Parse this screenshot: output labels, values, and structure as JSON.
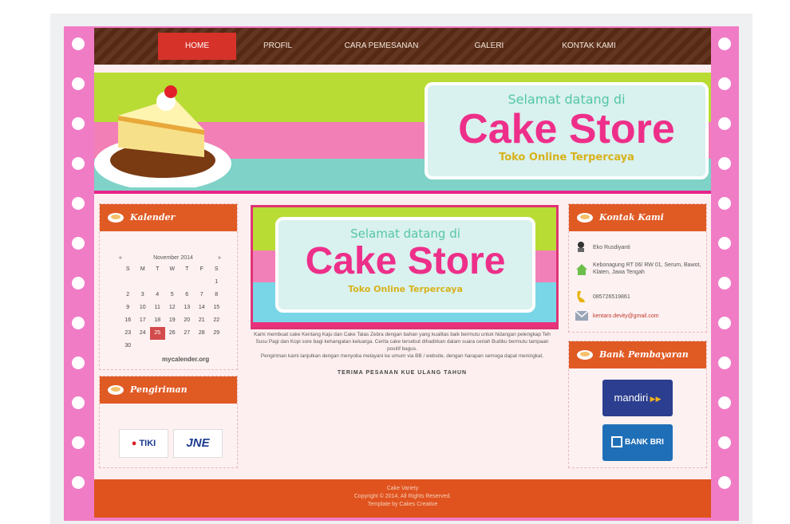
{
  "nav": {
    "items": [
      {
        "label": "HOME",
        "active": true
      },
      {
        "label": "PROFIL",
        "active": false
      },
      {
        "label": "CARA PEMESANAN",
        "active": false
      },
      {
        "label": "GALERI",
        "active": false
      },
      {
        "label": "KONTAK KAMI",
        "active": false
      }
    ]
  },
  "banner": {
    "welcome": "Selamat datang di",
    "title": "Cake Store",
    "tagline": "Toko Online Terpercaya"
  },
  "left": {
    "calendar_title": "Kalender",
    "calendar": {
      "prev": "«",
      "month": "November 2014",
      "next": "»",
      "weekdays": [
        "S",
        "M",
        "T",
        "W",
        "T",
        "F",
        "S"
      ],
      "weeks": [
        [
          "",
          "",
          "",
          "",
          "",
          "",
          "1"
        ],
        [
          "2",
          "3",
          "4",
          "5",
          "6",
          "7",
          "8"
        ],
        [
          "9",
          "10",
          "11",
          "12",
          "13",
          "14",
          "15"
        ],
        [
          "16",
          "17",
          "18",
          "19",
          "20",
          "21",
          "22"
        ],
        [
          "23",
          "24",
          "25",
          "26",
          "27",
          "28",
          "29"
        ],
        [
          "30",
          "",
          "",
          "",
          "",
          "",
          ""
        ]
      ],
      "highlight": "25",
      "credit": "mycalender.org"
    },
    "shipping_title": "Pengiriman",
    "shipping": [
      "TIKI",
      "JNE"
    ]
  },
  "main": {
    "welcome": "Selamat datang di",
    "title": "Cake Store",
    "tagline": "Toko Online Terpercaya",
    "paragraph1": "Kami membuat cake Kentang Kaju dan Cake Talas Zebra dengan bahan yang kualitas baik bermutu untuk hidangan pelengkap Teh Susu Pagi dan Kopi sore bagi kehangatan keluarga. Cerita cake tersebut dihadirkan dalam suara ceriah Budiku bermutu tampaan positif bagus.",
    "paragraph2": "Pengiriman kami lanjutkan dengan menyoba melayani ke umum via BB / website, dengan harapan semoga dapat meningkat.",
    "notice": "TERIMA PESANAN KUE ULANG TAHUN"
  },
  "right": {
    "contact_title": "Kontak Kami",
    "contact": {
      "name": "Eko Rusdiyanti",
      "address": "Kebonagung RT 06/ RW 01, Serum, Bawot, Klaten, Jawa Tengah",
      "phone": "085726519861",
      "email": "kentaro.devity@gmail.com"
    },
    "bank_title": "Bank Pembayaran",
    "banks": [
      "mandiri",
      "BANK BRI"
    ]
  },
  "footer": {
    "line1": "Cake Variety",
    "line2": "Copyright © 2014, All Rights Reserved.",
    "line3": "Template by Cakes Creative"
  },
  "colors": {
    "page_pink": "#f07cc6",
    "nav_brown": "#5b2b15",
    "nav_active": "#d6322a",
    "panel_orange": "#e05a24",
    "title_pink": "#ee2f8a",
    "tagline_gold": "#d8b21a"
  }
}
